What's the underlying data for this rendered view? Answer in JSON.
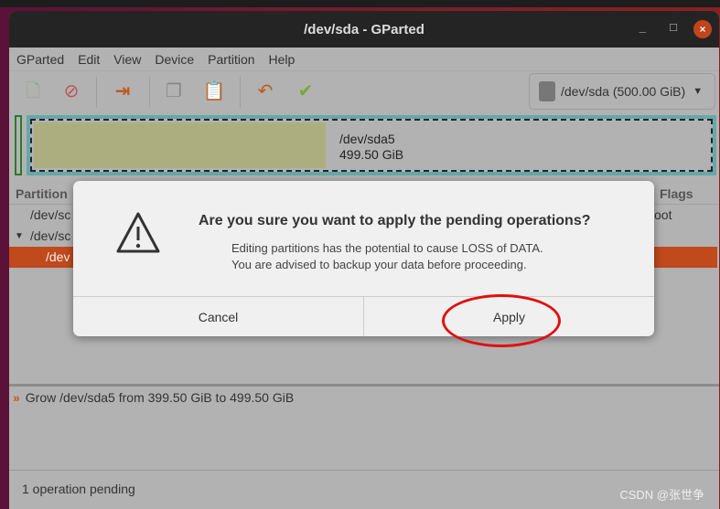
{
  "window": {
    "title": "/dev/sda - GParted",
    "minimize": "_",
    "maximize": "□",
    "close": "×"
  },
  "menu": [
    "GParted",
    "Edit",
    "View",
    "Device",
    "Partition",
    "Help"
  ],
  "toolbar": {
    "icons": [
      "new-partition-icon",
      "delete-icon",
      "resize-move-icon",
      "copy-icon",
      "paste-icon",
      "undo-icon",
      "apply-icon"
    ],
    "device": "/dev/sda (500.00 GiB)"
  },
  "disk_map": {
    "partition": "/dev/sda5",
    "size": "499.50 GiB",
    "used_fraction": 0.43
  },
  "table": {
    "headers": {
      "partition": "Partition",
      "flags": "Flags"
    },
    "rows": [
      {
        "name": "/dev/sc",
        "flags": "oot"
      },
      {
        "name": "/dev/sc",
        "flags": ""
      },
      {
        "name": "/dev",
        "flags": ""
      }
    ]
  },
  "dialog": {
    "title": "Are you sure you want to apply the pending operations?",
    "line1": "Editing partitions has the potential to cause LOSS of DATA.",
    "line2": "You are advised to backup your data before proceeding.",
    "cancel": "Cancel",
    "apply": "Apply"
  },
  "operations": [
    {
      "text": "Grow /dev/sda5 from 399.50 GiB to 499.50 GiB"
    }
  ],
  "status": "1 operation pending",
  "watermark": "CSDN @张世争",
  "colors": {
    "selected_row": "#c04a1c",
    "annotation": "#e01010"
  }
}
